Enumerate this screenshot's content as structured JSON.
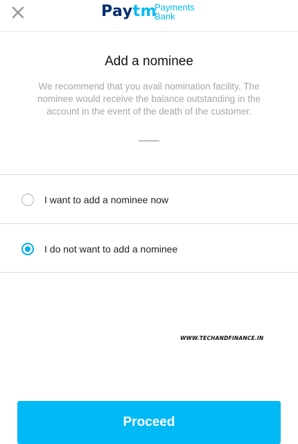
{
  "header": {
    "brand_main": "Paytm",
    "brand_sub_line1": "Payments",
    "brand_sub_line2": "Bank",
    "close_icon": "close-icon"
  },
  "main": {
    "title": "Add a nominee",
    "description": "We recommend that you avail nomination facility. The nominee would receive the balance outstanding in the account in the event of the death of the customer."
  },
  "options": [
    {
      "label": "I want to add a nominee now",
      "selected": false
    },
    {
      "label": "I do not want to add a nominee",
      "selected": true
    }
  ],
  "watermark": "WWW.TECHANDFINANCE.IN",
  "footer": {
    "proceed_label": "Proceed"
  },
  "colors": {
    "accent": "#00b9f1",
    "brand_navy": "#002e6e",
    "button": "#00b9f5"
  }
}
